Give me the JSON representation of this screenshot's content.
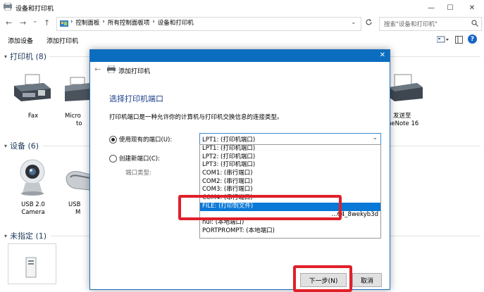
{
  "window": {
    "title": "设备和打印机",
    "controls": {
      "minimize": "—",
      "maximize": "☐",
      "close": "✕"
    }
  },
  "address": {
    "back": "←",
    "forward": "→",
    "dropdown": "⌄",
    "up": "↑",
    "crumbs": [
      "控制面板",
      "所有控制面板项",
      "设备和打印机"
    ],
    "separator": "›",
    "refresh": "⌄",
    "search_placeholder": "搜索\"设备和打印机\""
  },
  "toolbar": {
    "add_device": "添加设备",
    "add_printer": "添加打印机",
    "help": "?"
  },
  "groups": {
    "printers": {
      "label": "打印机 (8)"
    },
    "devices": {
      "label": "设备 (6)"
    },
    "unspecified": {
      "label": "未指定 (1)"
    }
  },
  "printers": {
    "fax": "Fax",
    "ms_partial_1": "Micro",
    "ms_partial_2": "to",
    "send_to_1": "发送至",
    "send_to_2": "neNote 16"
  },
  "devices": {
    "camera_1": "USB 2.0",
    "camera_2": "Camera",
    "usb_partial_1": "USB",
    "usb_partial_2": "M"
  },
  "dialog": {
    "close": "✕",
    "back": "←",
    "title": "添加打印机",
    "heading": "选择打印机端口",
    "description": "打印机端口是一种允许你的计算机与打印机交换信息的连接类型。",
    "use_existing_label": "使用现有的端口(U):",
    "create_new_label": "创建新端口(C):",
    "port_type_label": "端口类型:",
    "selected_port": "LPT1: (打印机端口)",
    "port_options": [
      "LPT1: (打印机端口)",
      "LPT2: (打印机端口)",
      "LPT3: (打印机端口)",
      "COM1: (串行端口)",
      "COM2: (串行端口)",
      "COM3: (串行端口)",
      "COM4: (串行端口)",
      "FILE: (打印到文件)",
      "...64_8wekyb3d",
      "nul: (本地端口)",
      "PORTPROMPT: (本地端口)"
    ],
    "selected_index": 7,
    "next_button": "下一步(N)",
    "cancel_button": "取消"
  },
  "colors": {
    "accent": "#0a78d7",
    "highlight_box": "#e0202a",
    "title_bar": "#0b6dbf"
  }
}
